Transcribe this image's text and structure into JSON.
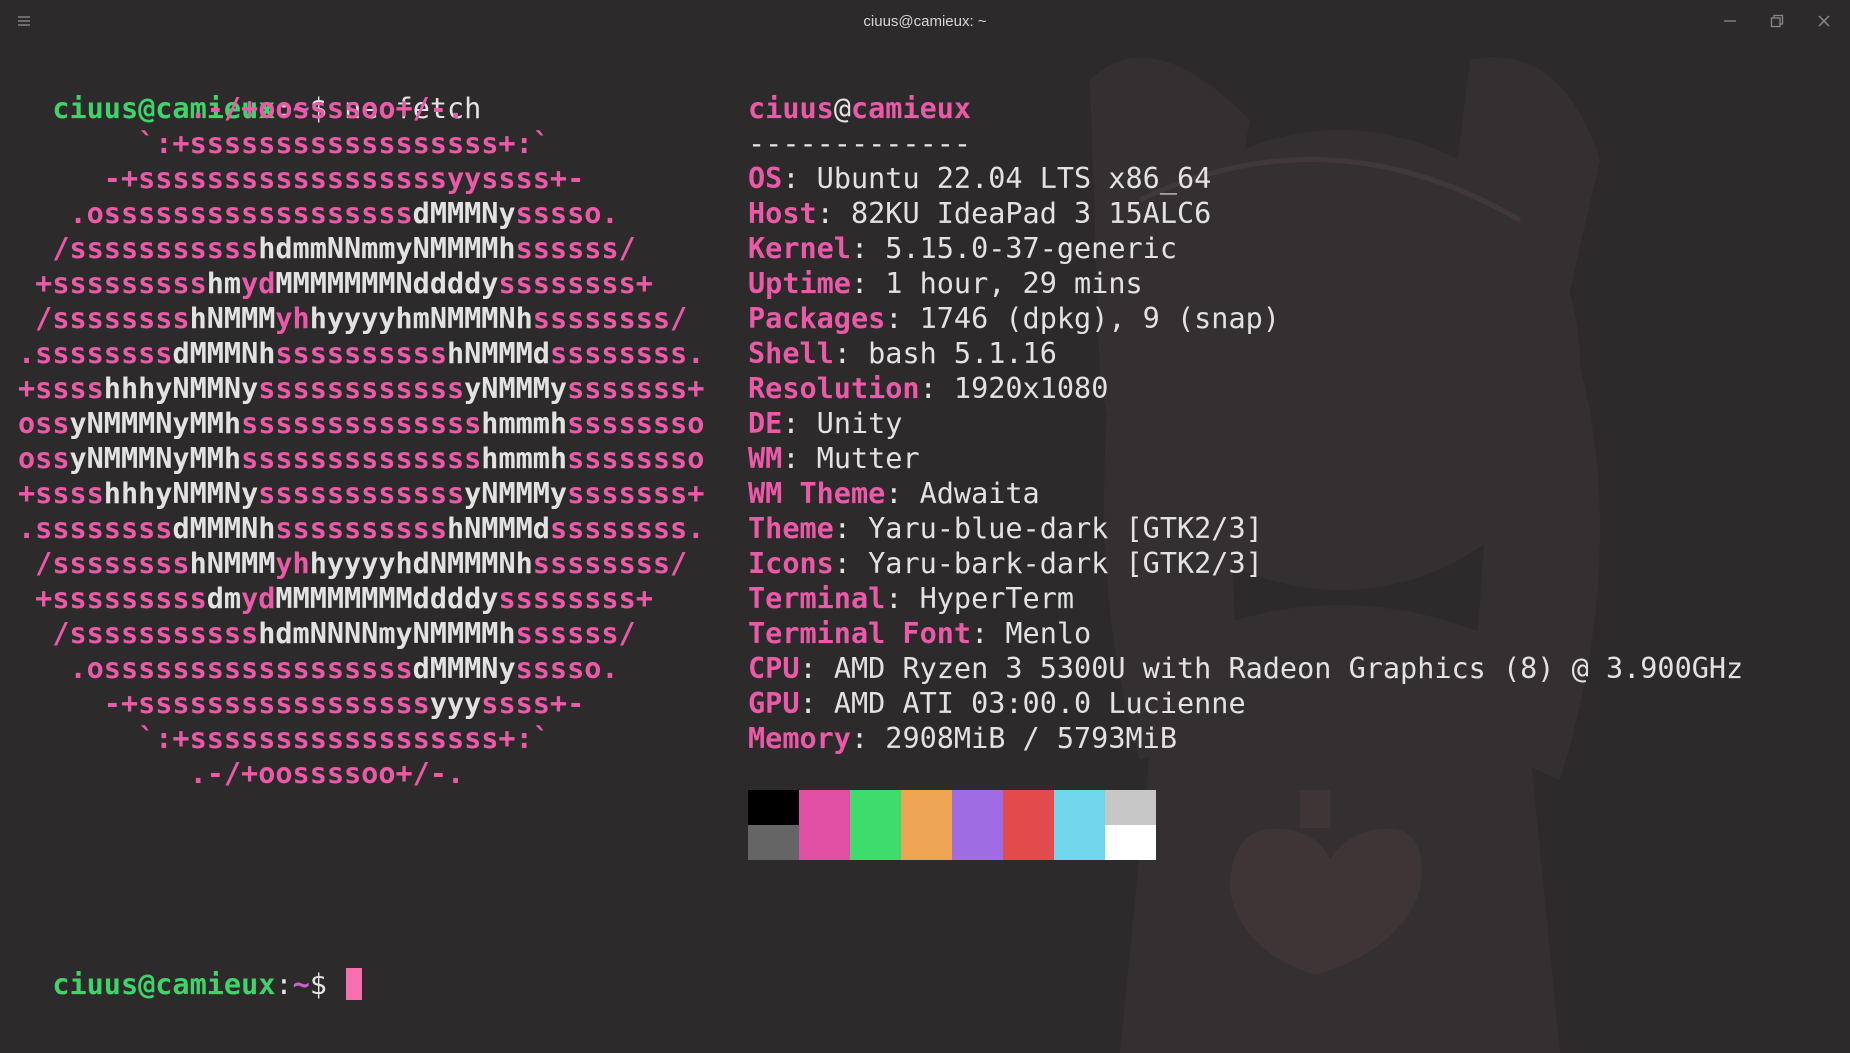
{
  "window": {
    "title": "ciuus@camieux: ~",
    "menu_icon": "hamburger-icon",
    "min_icon": "minimize-icon",
    "max_icon": "restore-icon",
    "close_icon": "close-icon"
  },
  "prompt": {
    "user_host": "ciuus@camieux",
    "colon": ":",
    "path": "~",
    "dollar": "$ ",
    "command": "neofetch"
  },
  "ascii_art": [
    [
      [
        "pk",
        "          .-/+oossssoo+/-."
      ]
    ],
    [
      [
        "pk",
        "       `:+ssssssssssssssssss+:`"
      ]
    ],
    [
      [
        "pk",
        "     -+ssssssssssssssssssyyssss+-"
      ]
    ],
    [
      [
        "pk",
        "   .ossssssssssssssssss"
      ],
      [
        "wh",
        "dMMMNy"
      ],
      [
        "pk",
        "sssso."
      ]
    ],
    [
      [
        "pk",
        "  /sssssssssss"
      ],
      [
        "wh",
        "hdmmNNmmyNMMMMh"
      ],
      [
        "pk",
        "ssssss/"
      ]
    ],
    [
      [
        "pk",
        " +sssssssss"
      ],
      [
        "wh",
        "hm"
      ],
      [
        "pk",
        "yd"
      ],
      [
        "wh",
        "MMMMMMMNddddy"
      ],
      [
        "pk",
        "ssssssss+"
      ]
    ],
    [
      [
        "pk",
        " /ssssssss"
      ],
      [
        "wh",
        "hNMMM"
      ],
      [
        "pk",
        "yh"
      ],
      [
        "wh",
        "hyyyyhmNMMMNh"
      ],
      [
        "pk",
        "ssssssss/"
      ]
    ],
    [
      [
        "pk",
        ".ssssssss"
      ],
      [
        "wh",
        "dMMMNh"
      ],
      [
        "pk",
        "ssssssssss"
      ],
      [
        "wh",
        "hNMMMd"
      ],
      [
        "pk",
        "ssssssss."
      ]
    ],
    [
      [
        "pk",
        "+ssss"
      ],
      [
        "wh",
        "hhhyNMMNy"
      ],
      [
        "pk",
        "ssssssssssss"
      ],
      [
        "wh",
        "yNMMMy"
      ],
      [
        "pk",
        "sssssss+"
      ]
    ],
    [
      [
        "pk",
        "oss"
      ],
      [
        "wh",
        "yNMMMNyMMh"
      ],
      [
        "pk",
        "ssssssssssssss"
      ],
      [
        "wh",
        "hmmmh"
      ],
      [
        "pk",
        "ssssssso"
      ]
    ],
    [
      [
        "pk",
        "oss"
      ],
      [
        "wh",
        "yNMMMNyMMh"
      ],
      [
        "pk",
        "ssssssssssssss"
      ],
      [
        "wh",
        "hmmmh"
      ],
      [
        "pk",
        "ssssssso"
      ]
    ],
    [
      [
        "pk",
        "+ssss"
      ],
      [
        "wh",
        "hhhyNMMNy"
      ],
      [
        "pk",
        "ssssssssssss"
      ],
      [
        "wh",
        "yNMMMy"
      ],
      [
        "pk",
        "sssssss+"
      ]
    ],
    [
      [
        "pk",
        ".ssssssss"
      ],
      [
        "wh",
        "dMMMNh"
      ],
      [
        "pk",
        "ssssssssss"
      ],
      [
        "wh",
        "hNMMMd"
      ],
      [
        "pk",
        "ssssssss."
      ]
    ],
    [
      [
        "pk",
        " /ssssssss"
      ],
      [
        "wh",
        "hNMMM"
      ],
      [
        "pk",
        "yh"
      ],
      [
        "wh",
        "hyyyyhdNMMMNh"
      ],
      [
        "pk",
        "ssssssss/"
      ]
    ],
    [
      [
        "pk",
        " +sssssssss"
      ],
      [
        "wh",
        "dm"
      ],
      [
        "pk",
        "yd"
      ],
      [
        "wh",
        "MMMMMMMMddddy"
      ],
      [
        "pk",
        "ssssssss+"
      ]
    ],
    [
      [
        "pk",
        "  /sssssssssss"
      ],
      [
        "wh",
        "hdmNNNNmyNMMMMh"
      ],
      [
        "pk",
        "ssssss/"
      ]
    ],
    [
      [
        "pk",
        "   .ossssssssssssssssss"
      ],
      [
        "wh",
        "dMMMNy"
      ],
      [
        "pk",
        "sssso."
      ]
    ],
    [
      [
        "pk",
        "     -+sssssssssssssssss"
      ],
      [
        "wh",
        "yyy"
      ],
      [
        "pk",
        "ssss+-"
      ]
    ],
    [
      [
        "pk",
        "       `:+ssssssssssssssssss+:`"
      ]
    ],
    [
      [
        "pk",
        "          .-/+oossssoo+/-."
      ]
    ]
  ],
  "info": {
    "user": "ciuus",
    "at": "@",
    "host": "camieux",
    "separator": "-------------",
    "fields": [
      {
        "key": "OS",
        "value": "Ubuntu 22.04 LTS x86_64"
      },
      {
        "key": "Host",
        "value": "82KU IdeaPad 3 15ALC6"
      },
      {
        "key": "Kernel",
        "value": "5.15.0-37-generic"
      },
      {
        "key": "Uptime",
        "value": "1 hour, 29 mins"
      },
      {
        "key": "Packages",
        "value": "1746 (dpkg), 9 (snap)"
      },
      {
        "key": "Shell",
        "value": "bash 5.1.16"
      },
      {
        "key": "Resolution",
        "value": "1920x1080"
      },
      {
        "key": "DE",
        "value": "Unity"
      },
      {
        "key": "WM",
        "value": "Mutter"
      },
      {
        "key": "WM Theme",
        "value": "Adwaita"
      },
      {
        "key": "Theme",
        "value": "Yaru-blue-dark [GTK2/3]"
      },
      {
        "key": "Icons",
        "value": "Yaru-bark-dark [GTK2/3]"
      },
      {
        "key": "Terminal",
        "value": "HyperTerm"
      },
      {
        "key": "Terminal Font",
        "value": "Menlo"
      },
      {
        "key": "CPU",
        "value": "AMD Ryzen 3 5300U with Radeon Graphics (8) @ 3.900GHz"
      },
      {
        "key": "GPU",
        "value": "AMD ATI 03:00.0 Lucienne"
      },
      {
        "key": "Memory",
        "value": "2908MiB / 5793MiB"
      }
    ]
  },
  "palette": {
    "top": [
      "#000000",
      "#e14fa5",
      "#3ddc6c",
      "#eea553",
      "#9f6ce3",
      "#e34a4b",
      "#6fd6ec",
      "#c7c7c7"
    ],
    "bottom": [
      "#656565",
      "#e14fa5",
      "#3ddc6c",
      "#eea553",
      "#9f6ce3",
      "#e34a4b",
      "#6fd6ec",
      "#ffffff"
    ]
  },
  "colors": {
    "pink": "#ea5aa8",
    "green": "#3ed46a",
    "purple": "#c766c9",
    "cursor": "#f56fb1",
    "background": "#2d2a2b"
  }
}
